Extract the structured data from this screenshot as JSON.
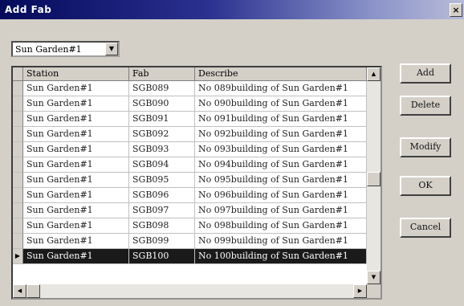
{
  "window": {
    "title": "Add Fab",
    "close_glyph": "×"
  },
  "station_select": {
    "value": "Sun Garden#1"
  },
  "grid": {
    "columns": [
      "Station",
      "Fab",
      "Describe"
    ],
    "rows": [
      {
        "station": "Sun Garden#1",
        "fab": "SGB089",
        "describe": "No 089building of Sun Garden#1"
      },
      {
        "station": "Sun Garden#1",
        "fab": "SGB090",
        "describe": "No 090building of Sun Garden#1"
      },
      {
        "station": "Sun Garden#1",
        "fab": "SGB091",
        "describe": "No 091building of Sun Garden#1"
      },
      {
        "station": "Sun Garden#1",
        "fab": "SGB092",
        "describe": "No 092building of Sun Garden#1"
      },
      {
        "station": "Sun Garden#1",
        "fab": "SGB093",
        "describe": "No 093building of Sun Garden#1"
      },
      {
        "station": "Sun Garden#1",
        "fab": "SGB094",
        "describe": "No 094building of Sun Garden#1"
      },
      {
        "station": "Sun Garden#1",
        "fab": "SGB095",
        "describe": "No 095building of Sun Garden#1"
      },
      {
        "station": "Sun Garden#1",
        "fab": "SGB096",
        "describe": "No 096building of Sun Garden#1"
      },
      {
        "station": "Sun Garden#1",
        "fab": "SGB097",
        "describe": "No 097building of Sun Garden#1"
      },
      {
        "station": "Sun Garden#1",
        "fab": "SGB098",
        "describe": "No 098building of Sun Garden#1"
      },
      {
        "station": "Sun Garden#1",
        "fab": "SGB099",
        "describe": "No 099building of Sun Garden#1"
      },
      {
        "station": "Sun Garden#1",
        "fab": "SGB100",
        "describe": "No 100building of Sun Garden#1"
      }
    ],
    "selected_index": 11
  },
  "buttons": {
    "add": "Add",
    "delete": "Delete",
    "modify": "Modify",
    "ok": "OK",
    "cancel": "Cancel"
  },
  "icons": {
    "close": "close-icon",
    "dropdown": "chevron-down-icon",
    "row_pointer": "triangle-right-icon"
  }
}
